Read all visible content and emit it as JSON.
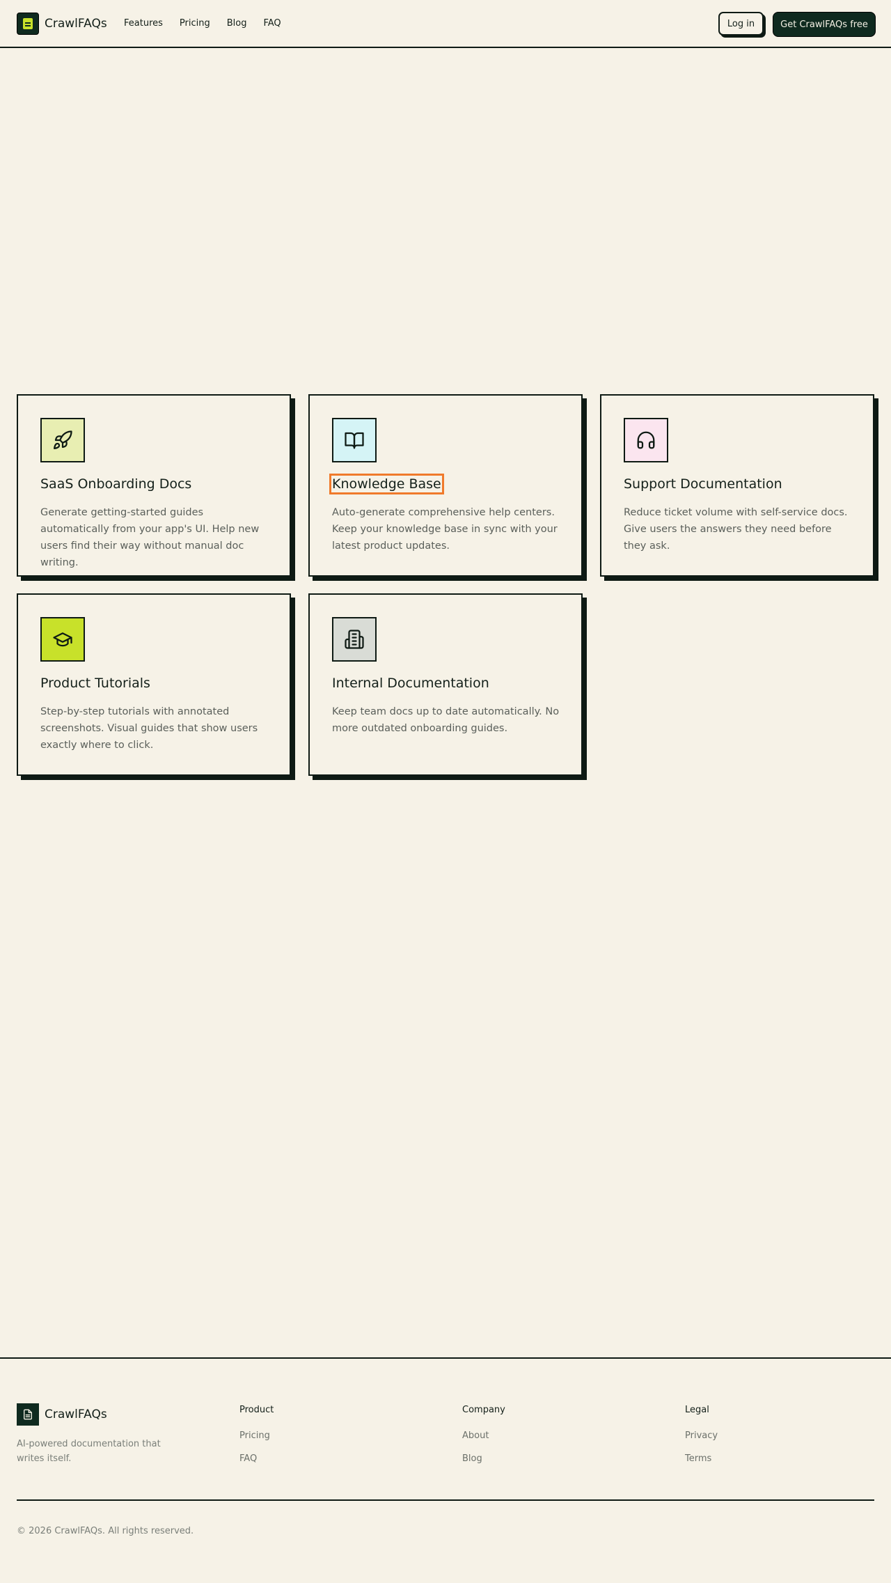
{
  "header": {
    "brand": "CrawlFAQs",
    "nav": [
      "Features",
      "Pricing",
      "Blog",
      "FAQ"
    ],
    "login_label": "Log in",
    "cta_label": "Get CrawlFAQs free"
  },
  "cards": [
    {
      "title": "SaaS Onboarding Docs",
      "description": "Generate getting-started guides automatically from your app's UI. Help new users find their way without manual doc writing.",
      "icon": "rocket-icon",
      "icon_bg": "#e8eeb2"
    },
    {
      "title": "Knowledge Base",
      "description": "Auto-generate comprehensive help centers. Keep your knowledge base in sync with your latest product updates.",
      "icon": "book-open-icon",
      "icon_bg": "#d5f4f6"
    },
    {
      "title": "Support Documentation",
      "description": "Reduce ticket volume with self-service docs. Give users the answers they need before they ask.",
      "icon": "headphones-icon",
      "icon_bg": "#fbe5ef"
    },
    {
      "title": "Product Tutorials",
      "description": "Step-by-step tutorials with annotated screenshots. Visual guides that show users exactly where to click.",
      "icon": "graduation-cap-icon",
      "icon_bg": "#c8e12a"
    },
    {
      "title": "Internal Documentation",
      "description": "Keep team docs up to date automatically. No more outdated onboarding guides.",
      "icon": "building-icon",
      "icon_bg": "#d9dcd6"
    }
  ],
  "footer": {
    "brand": "CrawlFAQs",
    "tagline": "AI-powered documentation that writes itself.",
    "columns": [
      {
        "heading": "Product",
        "links": [
          "Pricing",
          "FAQ"
        ]
      },
      {
        "heading": "Company",
        "links": [
          "About",
          "Blog"
        ]
      },
      {
        "heading": "Legal",
        "links": [
          "Privacy",
          "Terms"
        ]
      }
    ],
    "copyright": "© 2026 CrawlFAQs. All rights reserved."
  },
  "colors": {
    "background": "#f6f2e7",
    "ink": "#0e1a14",
    "dark_green": "#0f2a1f",
    "lime": "#c8e12a",
    "highlight": "#f07a2b"
  }
}
